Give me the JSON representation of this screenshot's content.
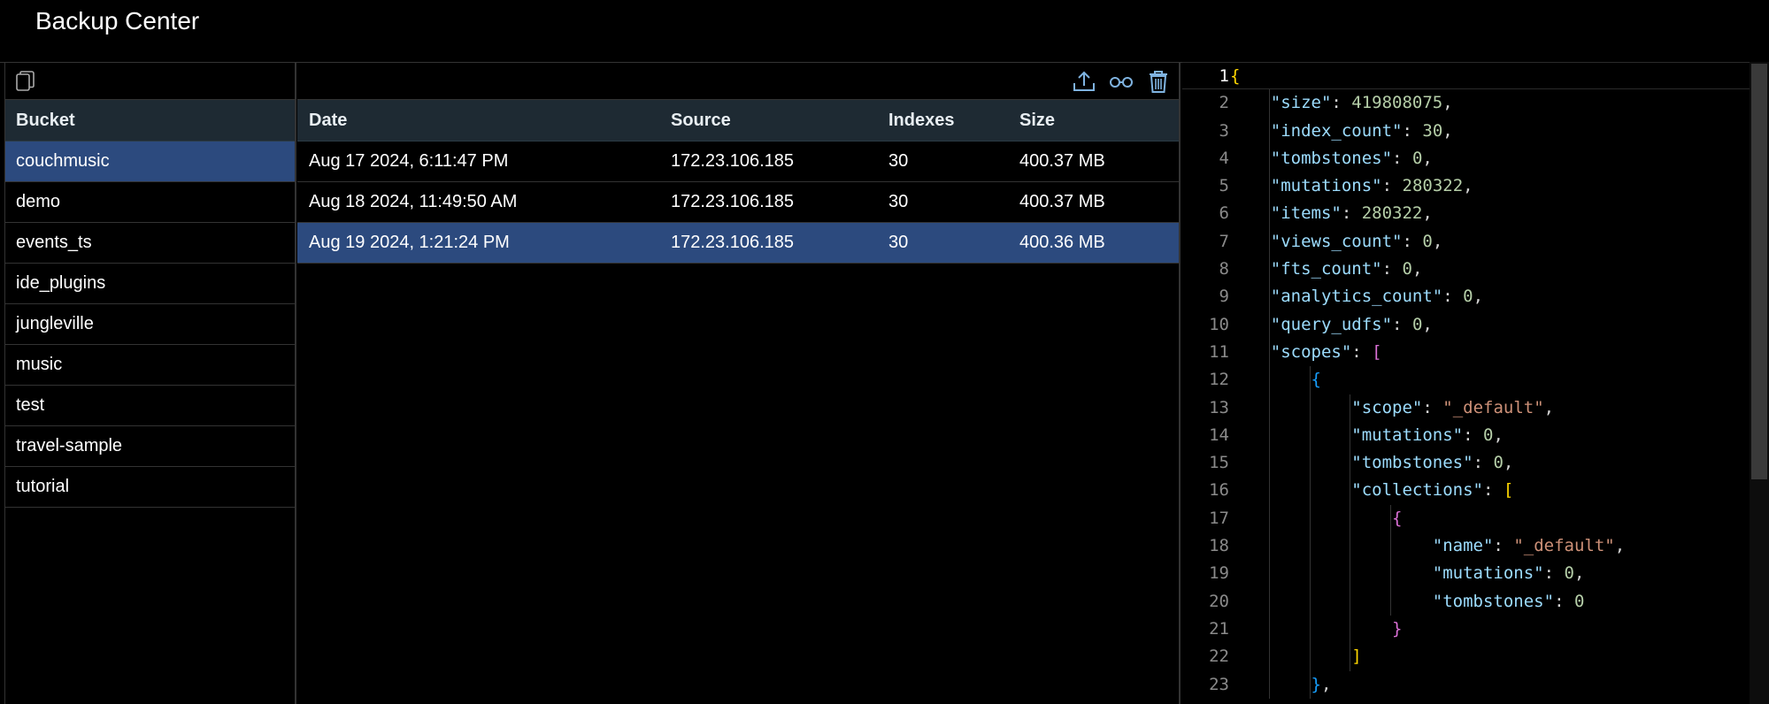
{
  "window": {
    "title": "Backup Center"
  },
  "buckets": {
    "header": "Bucket",
    "items": [
      {
        "label": "couchmusic",
        "selected": true
      },
      {
        "label": "demo",
        "selected": false
      },
      {
        "label": "events_ts",
        "selected": false
      },
      {
        "label": "ide_plugins",
        "selected": false
      },
      {
        "label": "jungleville",
        "selected": false
      },
      {
        "label": "music",
        "selected": false
      },
      {
        "label": "test",
        "selected": false
      },
      {
        "label": "travel-sample",
        "selected": false
      },
      {
        "label": "tutorial",
        "selected": false
      }
    ]
  },
  "backups": {
    "columns": {
      "date": "Date",
      "source": "Source",
      "indexes": "Indexes",
      "size": "Size"
    },
    "rows": [
      {
        "date": "Aug 17 2024, 6:11:47 PM",
        "source": "172.23.106.185",
        "indexes": "30",
        "size": "400.37 MB",
        "selected": false
      },
      {
        "date": "Aug 18 2024, 11:49:50 AM",
        "source": "172.23.106.185",
        "indexes": "30",
        "size": "400.37 MB",
        "selected": false
      },
      {
        "date": "Aug 19 2024, 1:21:24 PM",
        "source": "172.23.106.185",
        "indexes": "30",
        "size": "400.36 MB",
        "selected": true
      }
    ],
    "toolbar_icons": [
      "upload-icon",
      "glasses-icon",
      "trash-icon"
    ]
  },
  "editor": {
    "current_line": 1,
    "lines": [
      [
        [
          "b1",
          "{"
        ]
      ],
      [
        [
          "p",
          "    "
        ],
        [
          "k",
          "\"size\""
        ],
        [
          "p",
          ": "
        ],
        [
          "n",
          "419808075"
        ],
        [
          "p",
          ","
        ]
      ],
      [
        [
          "p",
          "    "
        ],
        [
          "k",
          "\"index_count\""
        ],
        [
          "p",
          ": "
        ],
        [
          "n",
          "30"
        ],
        [
          "p",
          ","
        ]
      ],
      [
        [
          "p",
          "    "
        ],
        [
          "k",
          "\"tombstones\""
        ],
        [
          "p",
          ": "
        ],
        [
          "n",
          "0"
        ],
        [
          "p",
          ","
        ]
      ],
      [
        [
          "p",
          "    "
        ],
        [
          "k",
          "\"mutations\""
        ],
        [
          "p",
          ": "
        ],
        [
          "n",
          "280322"
        ],
        [
          "p",
          ","
        ]
      ],
      [
        [
          "p",
          "    "
        ],
        [
          "k",
          "\"items\""
        ],
        [
          "p",
          ": "
        ],
        [
          "n",
          "280322"
        ],
        [
          "p",
          ","
        ]
      ],
      [
        [
          "p",
          "    "
        ],
        [
          "k",
          "\"views_count\""
        ],
        [
          "p",
          ": "
        ],
        [
          "n",
          "0"
        ],
        [
          "p",
          ","
        ]
      ],
      [
        [
          "p",
          "    "
        ],
        [
          "k",
          "\"fts_count\""
        ],
        [
          "p",
          ": "
        ],
        [
          "n",
          "0"
        ],
        [
          "p",
          ","
        ]
      ],
      [
        [
          "p",
          "    "
        ],
        [
          "k",
          "\"analytics_count\""
        ],
        [
          "p",
          ": "
        ],
        [
          "n",
          "0"
        ],
        [
          "p",
          ","
        ]
      ],
      [
        [
          "p",
          "    "
        ],
        [
          "k",
          "\"query_udfs\""
        ],
        [
          "p",
          ": "
        ],
        [
          "n",
          "0"
        ],
        [
          "p",
          ","
        ]
      ],
      [
        [
          "p",
          "    "
        ],
        [
          "k",
          "\"scopes\""
        ],
        [
          "p",
          ": "
        ],
        [
          "b2",
          "["
        ]
      ],
      [
        [
          "p",
          "        "
        ],
        [
          "b3",
          "{"
        ]
      ],
      [
        [
          "p",
          "            "
        ],
        [
          "k",
          "\"scope\""
        ],
        [
          "p",
          ": "
        ],
        [
          "s",
          "\"_default\""
        ],
        [
          "p",
          ","
        ]
      ],
      [
        [
          "p",
          "            "
        ],
        [
          "k",
          "\"mutations\""
        ],
        [
          "p",
          ": "
        ],
        [
          "n",
          "0"
        ],
        [
          "p",
          ","
        ]
      ],
      [
        [
          "p",
          "            "
        ],
        [
          "k",
          "\"tombstones\""
        ],
        [
          "p",
          ": "
        ],
        [
          "n",
          "0"
        ],
        [
          "p",
          ","
        ]
      ],
      [
        [
          "p",
          "            "
        ],
        [
          "k",
          "\"collections\""
        ],
        [
          "p",
          ": "
        ],
        [
          "b1",
          "["
        ]
      ],
      [
        [
          "p",
          "                "
        ],
        [
          "b2",
          "{"
        ]
      ],
      [
        [
          "p",
          "                    "
        ],
        [
          "k",
          "\"name\""
        ],
        [
          "p",
          ": "
        ],
        [
          "s",
          "\"_default\""
        ],
        [
          "p",
          ","
        ]
      ],
      [
        [
          "p",
          "                    "
        ],
        [
          "k",
          "\"mutations\""
        ],
        [
          "p",
          ": "
        ],
        [
          "n",
          "0"
        ],
        [
          "p",
          ","
        ]
      ],
      [
        [
          "p",
          "                    "
        ],
        [
          "k",
          "\"tombstones\""
        ],
        [
          "p",
          ": "
        ],
        [
          "n",
          "0"
        ]
      ],
      [
        [
          "p",
          "                "
        ],
        [
          "b2",
          "}"
        ]
      ],
      [
        [
          "p",
          "            "
        ],
        [
          "b1",
          "]"
        ]
      ],
      [
        [
          "p",
          "        "
        ],
        [
          "b3",
          "}"
        ],
        [
          "p",
          ","
        ]
      ]
    ]
  },
  "colors": {
    "selection": "#2c4a7e",
    "header_bg": "#1e2a33",
    "background": "#000000"
  }
}
